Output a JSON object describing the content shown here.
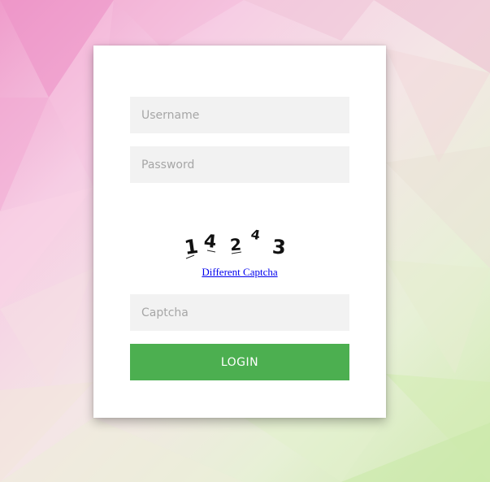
{
  "login_form": {
    "username_placeholder": "Username",
    "password_placeholder": "Password",
    "captcha_placeholder": "Captcha",
    "different_captcha_label": "Different Captcha",
    "login_label": "LOGIN"
  },
  "captcha": {
    "characters": [
      "1",
      "4",
      "2",
      "4",
      "3"
    ]
  },
  "colors": {
    "login_button": "#4caf50",
    "field_background": "#f2f2f2",
    "link": "#0000ee"
  }
}
